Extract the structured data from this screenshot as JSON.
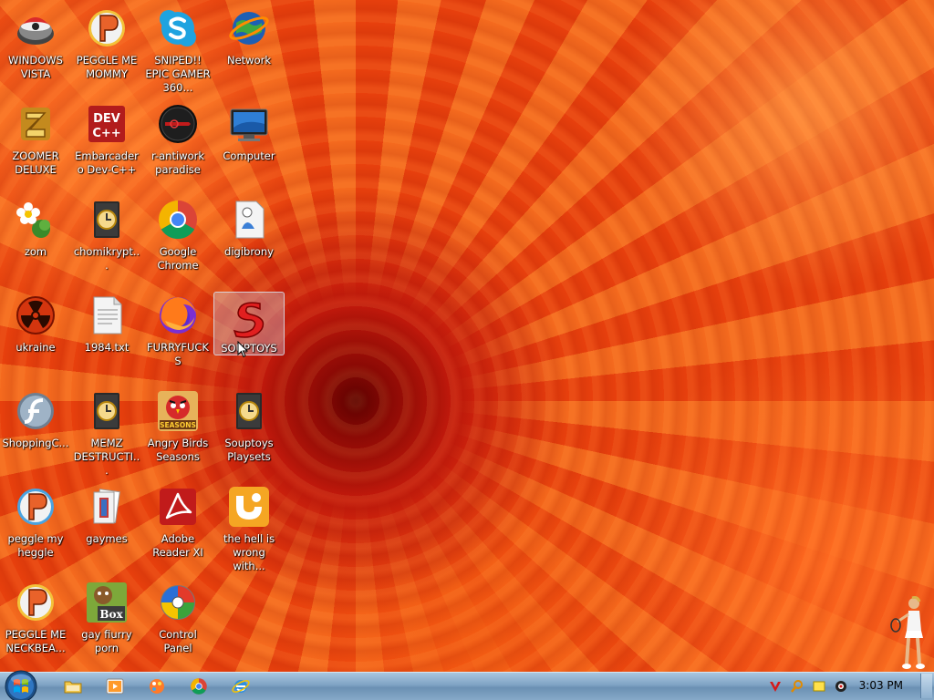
{
  "desktop": {
    "icons": [
      {
        "id": "windows-vista",
        "label": "WINDOWS VISTA",
        "icon": "orb-icon"
      },
      {
        "id": "peggle-me-mommy",
        "label": "PEGGLE ME MOMMY",
        "icon": "peggle-icon"
      },
      {
        "id": "sniped-epic-gamer",
        "label": "SNIPED!! EPIC GAMER 360...",
        "icon": "skype-icon"
      },
      {
        "id": "network",
        "label": "Network",
        "icon": "network-globe-icon"
      },
      {
        "id": "zoomer-deluxe",
        "label": "ZOOMER DELUXE",
        "icon": "zoomer-icon"
      },
      {
        "id": "embarcadero-devcpp",
        "label": "Embarcadero Dev-C++",
        "icon": "devcpp-icon"
      },
      {
        "id": "r-antiwork",
        "label": "r-antiwork paradise",
        "icon": "dark-orb-icon"
      },
      {
        "id": "computer",
        "label": "Computer",
        "icon": "computer-icon"
      },
      {
        "id": "zom",
        "label": "zom",
        "icon": "flower-icon"
      },
      {
        "id": "chomikrypt",
        "label": "chomikrypt...",
        "icon": "clock-document-icon"
      },
      {
        "id": "google-chrome",
        "label": "Google Chrome",
        "icon": "chrome-icon"
      },
      {
        "id": "digibrony",
        "label": "digibrony",
        "icon": "document-figure-icon"
      },
      {
        "id": "ukraine",
        "label": "ukraine",
        "icon": "radiation-icon"
      },
      {
        "id": "1984-txt",
        "label": "1984.txt",
        "icon": "text-file-icon"
      },
      {
        "id": "furryfucks",
        "label": "FURRYFUCKS",
        "icon": "firefox-icon"
      },
      {
        "id": "souptoys",
        "label": "SOUPTOYS",
        "icon": "souptoys-s-icon"
      },
      {
        "id": "shoppingc",
        "label": "ShoppingC...",
        "icon": "flash-icon"
      },
      {
        "id": "memz",
        "label": "MEMZ DESTRUCTI...",
        "icon": "clock-document-icon"
      },
      {
        "id": "angry-birds-seasons",
        "label": "Angry Birds Seasons",
        "icon": "angry-birds-icon"
      },
      {
        "id": "souptoys-playsets",
        "label": "Souptoys Playsets",
        "icon": "clock-document-icon"
      },
      {
        "id": "peggle-my-heggle",
        "label": "peggle my heggle",
        "icon": "peggle-icon"
      },
      {
        "id": "gaymes",
        "label": "gaymes",
        "icon": "folder-cards-icon"
      },
      {
        "id": "adobe-reader",
        "label": "Adobe Reader XI",
        "icon": "acrobat-icon"
      },
      {
        "id": "hell-is-wrong",
        "label": "the hell is wrong with...",
        "icon": "uc-browser-icon"
      },
      {
        "id": "peggle-me-neckbea",
        "label": "PEGGLE ME NECKBEA...",
        "icon": "peggle-icon"
      },
      {
        "id": "gay-fiurry-porn",
        "label": "gay fiurry porn",
        "icon": "box-icon"
      },
      {
        "id": "control-panel",
        "label": "Control Panel",
        "icon": "control-panel-icon"
      }
    ],
    "box_icon_text": "Box",
    "devcpp_icon_text_line1": "DEV",
    "devcpp_icon_text_line2": "C++",
    "seasons_icon_text": "SEASONS",
    "selected_icon": "souptoys"
  },
  "taskbar": {
    "start_icon": "windows-start-orb-icon",
    "pinned": [
      {
        "id": "explorer",
        "icon": "folder-icon"
      },
      {
        "id": "media-player",
        "icon": "media-player-icon"
      },
      {
        "id": "paint-app",
        "icon": "paint-icon"
      },
      {
        "id": "chrome",
        "icon": "chrome-icon"
      },
      {
        "id": "internet-explorer",
        "icon": "ie-icon"
      }
    ],
    "tray": [
      {
        "id": "tray-v",
        "icon": "v-logo-icon"
      },
      {
        "id": "tray-search",
        "icon": "magnifier-icon"
      },
      {
        "id": "tray-note",
        "icon": "note-icon"
      },
      {
        "id": "tray-eye",
        "icon": "eye-icon"
      }
    ],
    "clock": "3:03 PM"
  },
  "colors": {
    "taskbar_top": "#a9c6df",
    "taskbar_bottom": "#6b90b3",
    "selection": "#c8dcf0",
    "wallpaper_main": "#e9460f",
    "wallpaper_center": "#5a0000"
  }
}
